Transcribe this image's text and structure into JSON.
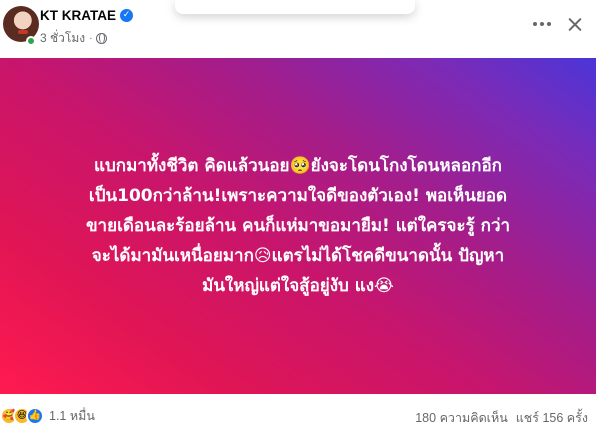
{
  "post": {
    "author": {
      "name": "KT KRATAE",
      "verified_icon": "verified-badge-icon"
    },
    "meta": {
      "time": "3 ชั่วโมง",
      "separator": "·",
      "privacy_icon": "globe-icon"
    },
    "actions": {
      "more_icon": "more-horizontal-icon",
      "close_icon": "close-icon"
    },
    "text": "แบกมาทั้งชีวิต คิดแล้วนอย🥺ยังจะโดนโกงโดนหลอกอีก\nเป็น100กว่าล้าน!เพราะความใจดีของตัวเอง! พอเห็นยอด\nขายเดือนละร้อยล้าน คนก็แห่มาขอมายืม! แต่ใครจะรู้ กว่า\nจะได้มามันเหนื่อยมาก😥แตรไม่ได้โชคดีขนาดนั้น ปัญหา\nมันใหญ่แต่ใจสู้อยู่งับ แง😭",
    "background": {
      "gradient_start": "#ff1a4f",
      "gradient_end": "#4b35d8",
      "text_color": "#ffffff"
    }
  },
  "footer": {
    "reaction_icons": [
      "care-icon",
      "haha-icon",
      "like-icon"
    ],
    "reaction_glyphs": {
      "care": "🥰",
      "haha": "😆",
      "like": "👍"
    },
    "reaction_count": "1.1 หมื่น",
    "comments": "180 ความคิดเห็น",
    "shares": "แชร์ 156 ครั้ง"
  },
  "colors": {
    "accent": "#1877f2",
    "secondary_text": "#65676b",
    "online": "#31a24c"
  }
}
